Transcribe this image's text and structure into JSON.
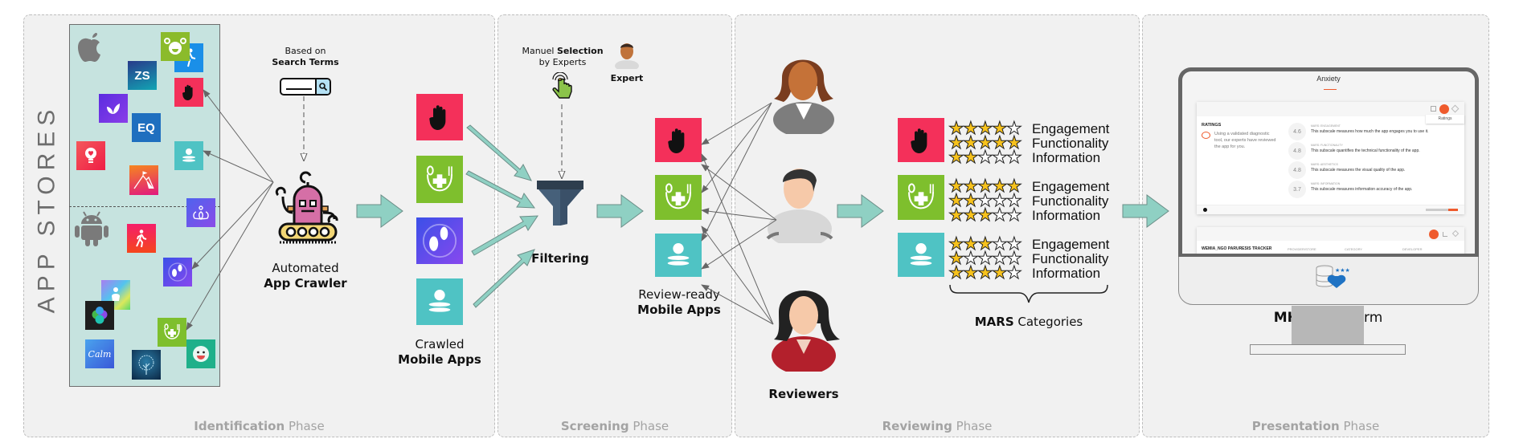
{
  "phases": [
    {
      "bold": "Identification",
      "rest": " Phase"
    },
    {
      "bold": "Screening",
      "rest": " Phase"
    },
    {
      "bold": "Reviewing",
      "rest": " Phase"
    },
    {
      "bold": "Presentation",
      "rest": " Phase"
    }
  ],
  "identification": {
    "side_label": "APP STORES",
    "stores": [
      "apple-icon",
      "android-icon"
    ],
    "search": {
      "line1": "Based on",
      "line2": "Search Terms"
    },
    "crawler": {
      "line1": "Automated",
      "line2": "App Crawler"
    },
    "store_apps": [
      {
        "name": "smiley-green",
        "color": "#8bbb2b"
      },
      {
        "name": "runner-blue",
        "color": "#1a8fe8"
      },
      {
        "name": "zs",
        "color": "#1e6fa0",
        "text": "ZS"
      },
      {
        "name": "hand-red",
        "color": "#f4305a"
      },
      {
        "name": "leaf-purple",
        "color": "#6a2be0"
      },
      {
        "name": "eq",
        "color": "#1f6fbf",
        "text": "EQ"
      },
      {
        "name": "bulb-red",
        "color": "#ef2b4b"
      },
      {
        "name": "meditation-teal",
        "color": "#4fc3c4"
      },
      {
        "name": "mountain-gradient",
        "color": "#f1522e"
      },
      {
        "name": "lotus-purple",
        "color": "#6a54ef"
      },
      {
        "name": "walk-red",
        "color": "#f3264f"
      },
      {
        "name": "footsteps-purple",
        "color": "#4d43e4"
      },
      {
        "name": "fitness-gradient",
        "color": "#8bbdf0"
      },
      {
        "name": "hex-dark",
        "color": "#1e1e1e"
      },
      {
        "name": "nutrition-green",
        "color": "#7ebf2d"
      },
      {
        "name": "calm-blue",
        "color": "#3a79e0",
        "text": "Calm"
      },
      {
        "name": "tree-dark",
        "color": "#0f3a5a"
      },
      {
        "name": "face-green",
        "color": "#1fb08a"
      }
    ]
  },
  "crawled": {
    "line1": "Crawled",
    "line2": "Mobile Apps",
    "apps": [
      {
        "name": "hand-app",
        "color": "#f4305a"
      },
      {
        "name": "nutrition-app",
        "color": "#7ebf2d"
      },
      {
        "name": "footsteps-app",
        "color": "#5a47e6"
      },
      {
        "name": "meditation-app",
        "color": "#4fc3c4"
      }
    ]
  },
  "screening": {
    "manual": {
      "pre": "Manuel ",
      "bold": "Selection",
      "line2": "by Experts"
    },
    "expert_label": "Expert",
    "filter_label": "Filtering",
    "ready": {
      "line1": "Review-ready",
      "line2": "Mobile Apps"
    }
  },
  "reviewing": {
    "reviewers_label": "Reviewers",
    "mars_bold": "MARS",
    "mars_rest": " Categories",
    "categories": [
      "Engagement",
      "Functionality",
      "Information"
    ],
    "apps": [
      {
        "name": "hand-app",
        "color": "#f4305a",
        "ratings": [
          4,
          5,
          2
        ]
      },
      {
        "name": "nutrition-app",
        "color": "#7ebf2d",
        "ratings": [
          5,
          2,
          3
        ]
      },
      {
        "name": "meditation-app",
        "color": "#4fc3c4",
        "ratings": [
          3,
          1,
          4
        ]
      }
    ],
    "max_stars": 5
  },
  "presentation": {
    "screen_title": "Anxiety",
    "card1": {
      "heading": "RATINGS",
      "desc": "Using a validated diagnostic tool, our experts have reviewed the app for you.",
      "tooltip": "Ratings",
      "rows": [
        {
          "score": "4.6",
          "label": "MARS: ENGAGEMENT",
          "text": "This subscale measures how much the app engages you to use it."
        },
        {
          "score": "4.8",
          "label": "MARS: FUNCTIONALITY",
          "text": "This subscale quantifies the technical functionality of the app."
        },
        {
          "score": "4.8",
          "label": "MARS: AESTHETICS",
          "text": "This subscale measures the visual quality of the app."
        },
        {
          "score": "3.7",
          "label": "MARS: INFORMATION",
          "text": "This subscale measures information accuracy of the app."
        }
      ]
    },
    "card2": {
      "title": "WEMIA_NGO PARURESIS TRACKER",
      "cols": [
        "PROVIDER/STORE",
        "CATEGORY",
        "DEVELOPER"
      ]
    },
    "platform_bold": "MHAD",
    "platform_rest": " Platform"
  },
  "colors": {
    "flow_arrow": "#8fd0c3",
    "phase_bg": "#f1f1f1",
    "accent_orange": "#ef5b2d"
  }
}
